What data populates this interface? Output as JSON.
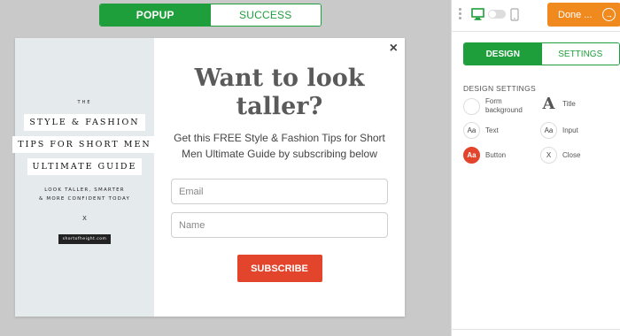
{
  "canvas_tabs": {
    "popup": "POPUP",
    "success": "SUCCESS"
  },
  "popup": {
    "close_glyph": "×",
    "left": {
      "the": "THE",
      "tags": [
        "STYLE & FASHION",
        "TIPS FOR SHORT MEN",
        "ULTIMATE GUIDE"
      ],
      "sub_line1": "LOOK TALLER, SMARTER",
      "sub_line2": "& MORE CONFIDENT TODAY",
      "x": "X",
      "site": "shortofheight.com"
    },
    "right": {
      "title": "Want to look taller?",
      "description": "Get this FREE Style & Fashion Tips for Short Men Ultimate Guide by subscribing below",
      "email_placeholder": "Email",
      "name_placeholder": "Name",
      "button": "SUBSCRIBE"
    }
  },
  "sidebar": {
    "done_label": "Done ...",
    "tabs": {
      "design": "DESIGN",
      "settings": "SETTINGS"
    },
    "section_title": "DESIGN SETTINGS",
    "options": {
      "form_background": {
        "line1": "Form",
        "line2": "background"
      },
      "title": {
        "icon": "A",
        "label": "Title"
      },
      "text": {
        "icon": "Aa",
        "label": "Text"
      },
      "input": {
        "icon": "Aa",
        "label": "Input"
      },
      "button": {
        "icon": "Aa",
        "label": "Button"
      },
      "close": {
        "icon": "X",
        "label": "Close"
      }
    }
  },
  "colors": {
    "green": "#1f9e3c",
    "orange": "#f08a1f",
    "red": "#e2452c"
  }
}
